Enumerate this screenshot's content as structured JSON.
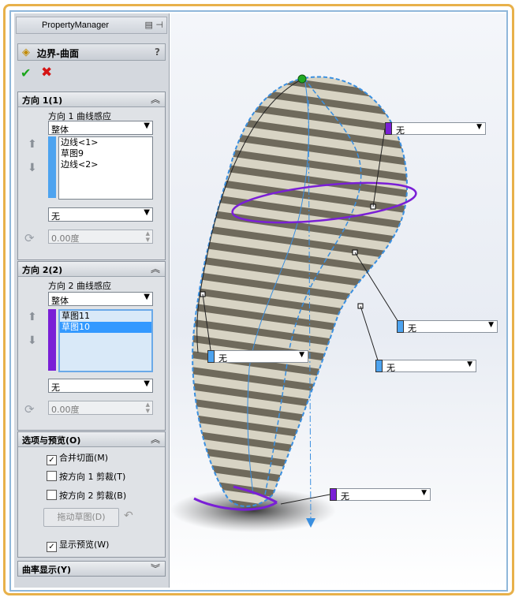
{
  "property_manager": {
    "title": "PropertyManager",
    "feature_name": "边界-曲面",
    "help": "?"
  },
  "direction1": {
    "header": "方向 1(1)",
    "tangency_label": "方向 1 曲线感应",
    "tangency_value": "整体",
    "items": [
      "边线<1>",
      "草图9",
      "边线<2>"
    ],
    "color": "#4da3ef",
    "end_condition": "无",
    "angle": "0.00度"
  },
  "direction2": {
    "header": "方向 2(2)",
    "tangency_label": "方向 2 曲线感应",
    "tangency_value": "整体",
    "items": [
      "草图11",
      "草图10"
    ],
    "selected_index": 1,
    "color": "#7a1fd6",
    "end_condition": "无",
    "angle": "0.00度"
  },
  "options": {
    "header": "选项与预览(O)",
    "merge_faces": "合并切面(M)",
    "merge_faces_checked": true,
    "trim_dir1": "按方向 1 剪裁(T)",
    "trim_dir1_checked": false,
    "trim_dir2": "按方向 2 剪裁(B)",
    "trim_dir2_checked": false,
    "drag_sketch": "拖动草图(D)",
    "show_preview": "显示预览(W)",
    "show_preview_checked": true
  },
  "curvature": {
    "header": "曲率显示(Y)"
  },
  "callouts": {
    "top_right": "无",
    "mid_right": "无",
    "mid_right2": "无",
    "left": "无",
    "bottom": "无"
  },
  "colors": {
    "frame": "#e8b14a",
    "dir1": "#4da3ef",
    "dir2": "#7a1fd6"
  }
}
